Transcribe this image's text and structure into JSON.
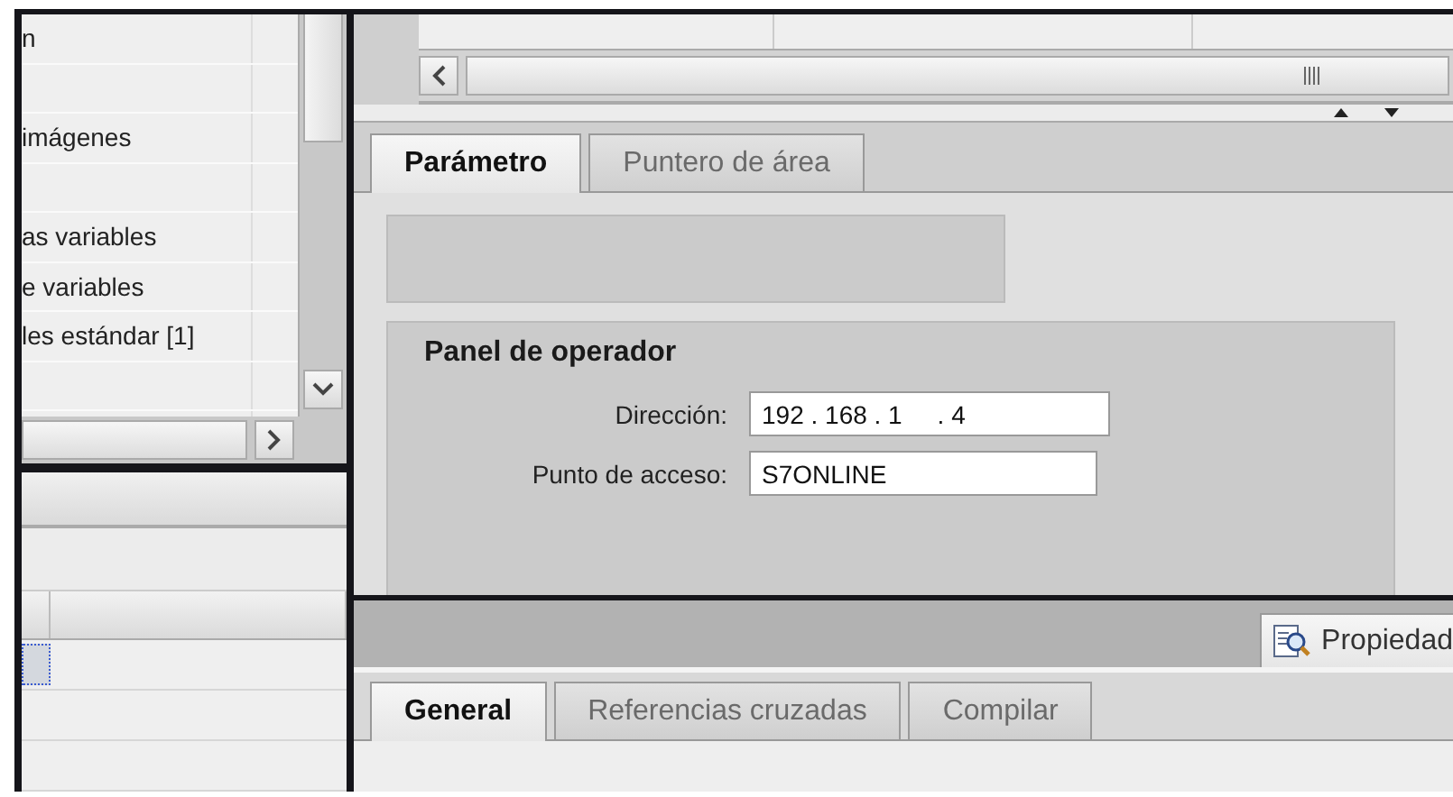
{
  "navigator": {
    "rows": [
      {
        "label": "n"
      },
      {},
      {
        "label": "imágenes"
      },
      {},
      {
        "label": "as variables"
      },
      {
        "label": "e variables"
      },
      {
        "label": "les estándar [1]"
      },
      {}
    ]
  },
  "details_table": {
    "rows": [
      {
        "selected": true
      },
      {
        "selected": false
      },
      {
        "selected": false
      }
    ]
  },
  "editor_tabs": [
    {
      "label": "Parámetro",
      "selected": true
    },
    {
      "label": "Puntero de área",
      "selected": false
    }
  ],
  "operator_panel": {
    "title": "Panel de operador",
    "fields": [
      {
        "label": "Dirección:",
        "value": "192 . 168 . 1     . 4"
      },
      {
        "label": "Punto de acceso:",
        "value": "S7ONLINE"
      }
    ]
  },
  "inspector": {
    "properties_button": "Propiedad",
    "tabs": [
      {
        "label": "General",
        "selected": true
      },
      {
        "label": "Referencias cruzadas",
        "selected": false
      },
      {
        "label": "Compilar",
        "selected": false
      }
    ]
  }
}
